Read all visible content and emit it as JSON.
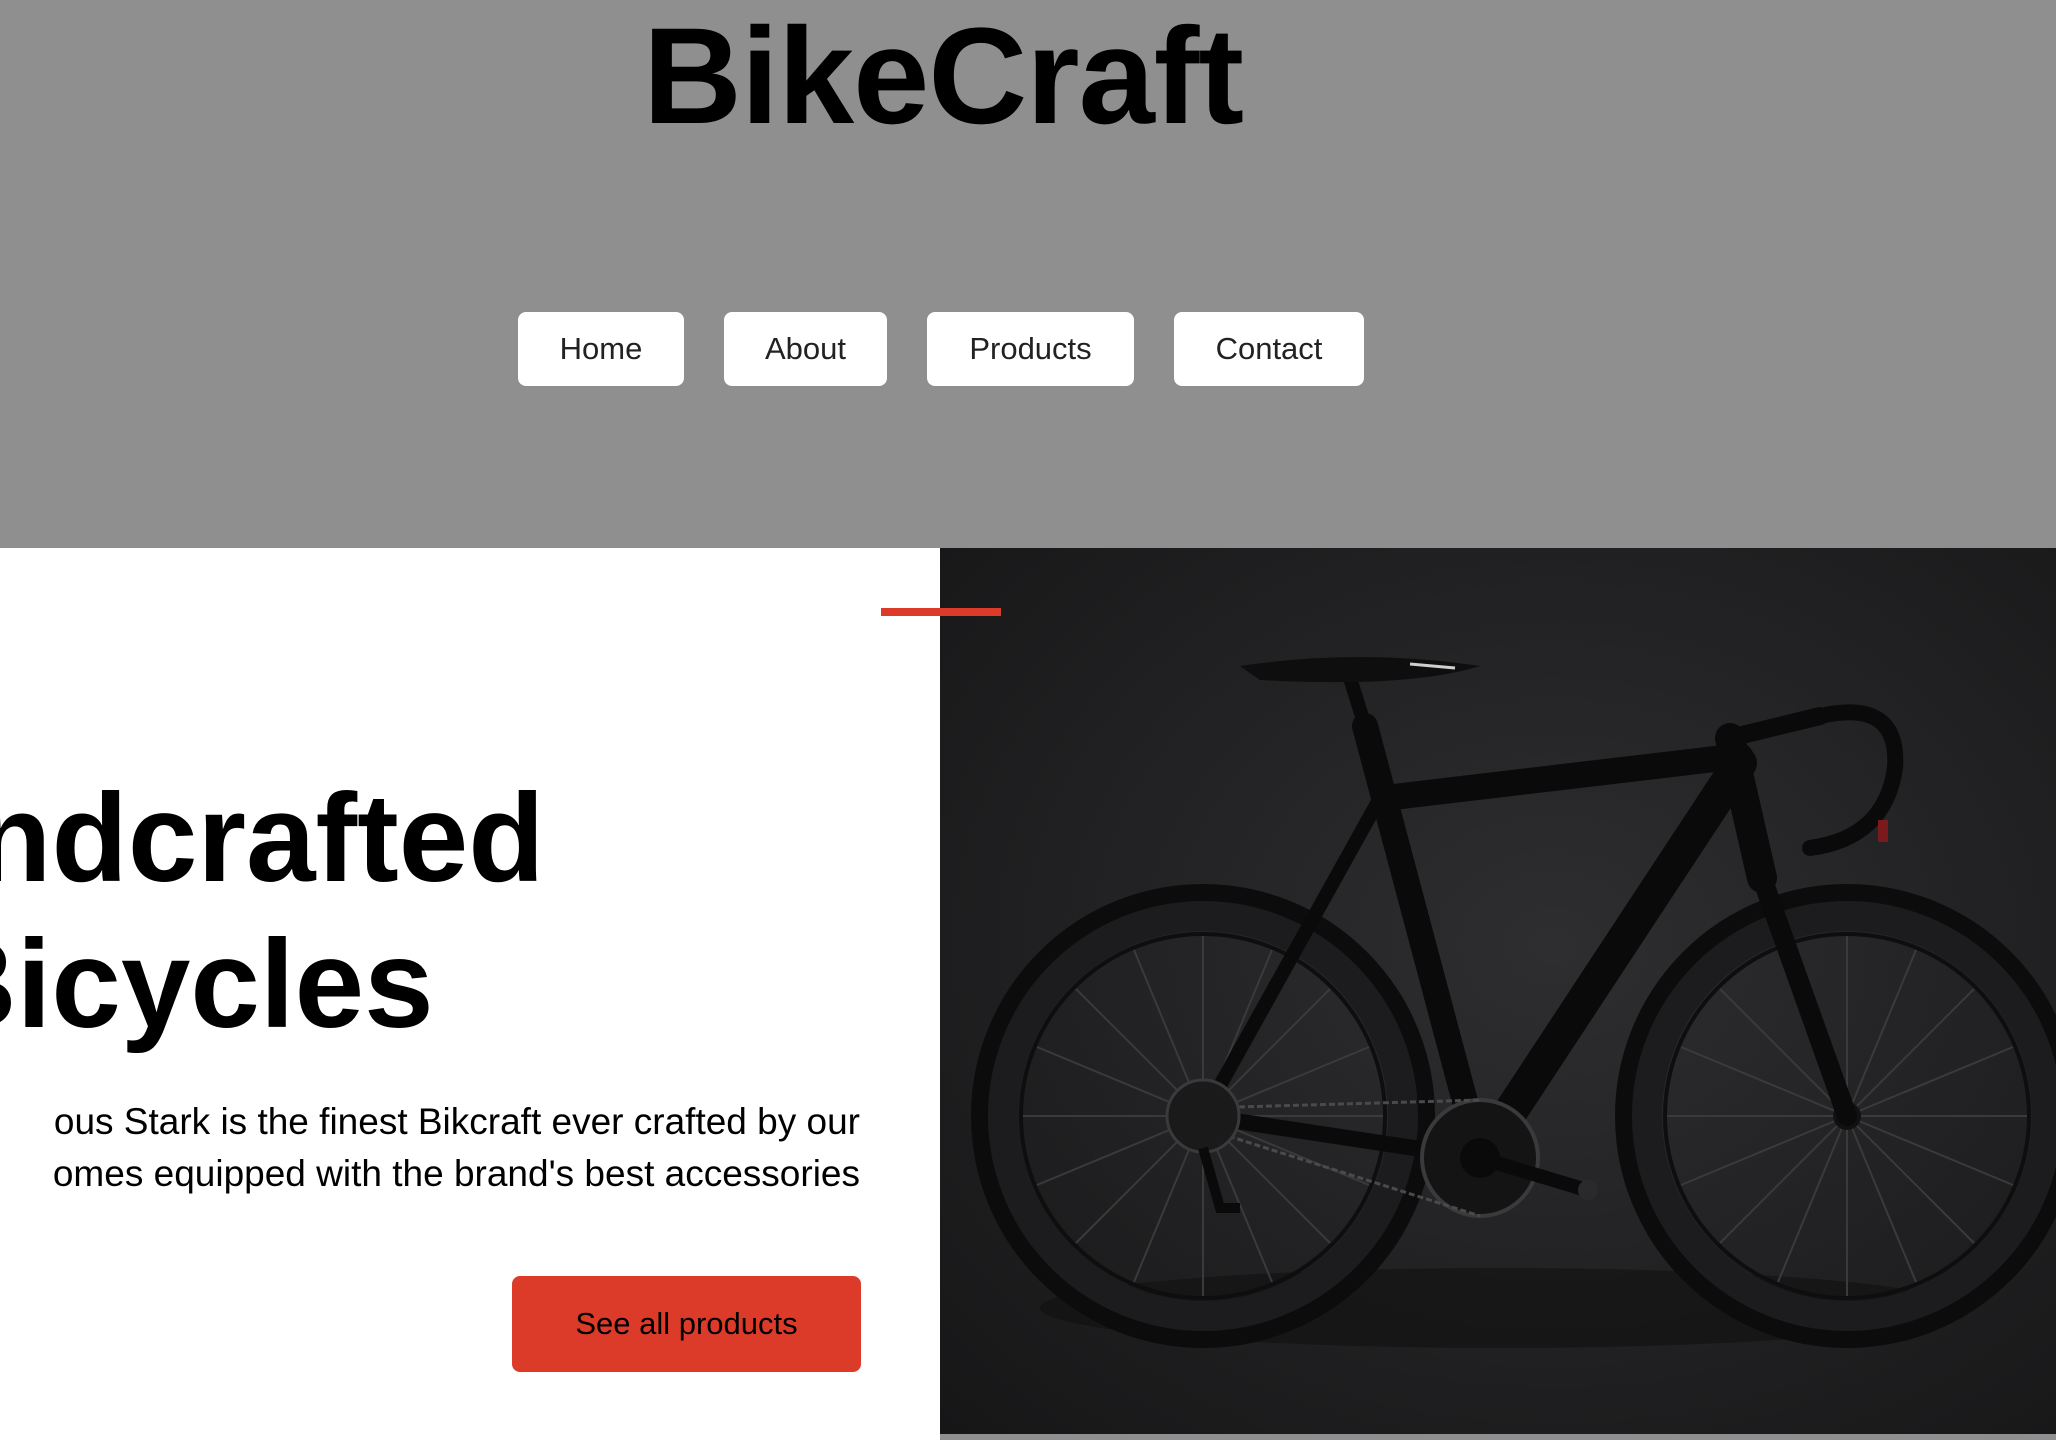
{
  "header": {
    "brand": "BikeCraft",
    "nav": [
      "Home",
      "About",
      "Products",
      "Contact"
    ]
  },
  "hero": {
    "title_line1": "Handcrafted",
    "title_line2": "Bicycles",
    "text_line1": "ous Stark is the finest Bikcraft ever crafted by our",
    "text_line2": "omes equipped with the brand's best accessories",
    "cta": "See all products",
    "image_subject": "black road bicycle on dark background"
  },
  "colors": {
    "header_bg": "#8f8f8f",
    "accent": "#dc3b2a",
    "hero_image_bg": "#222224"
  }
}
